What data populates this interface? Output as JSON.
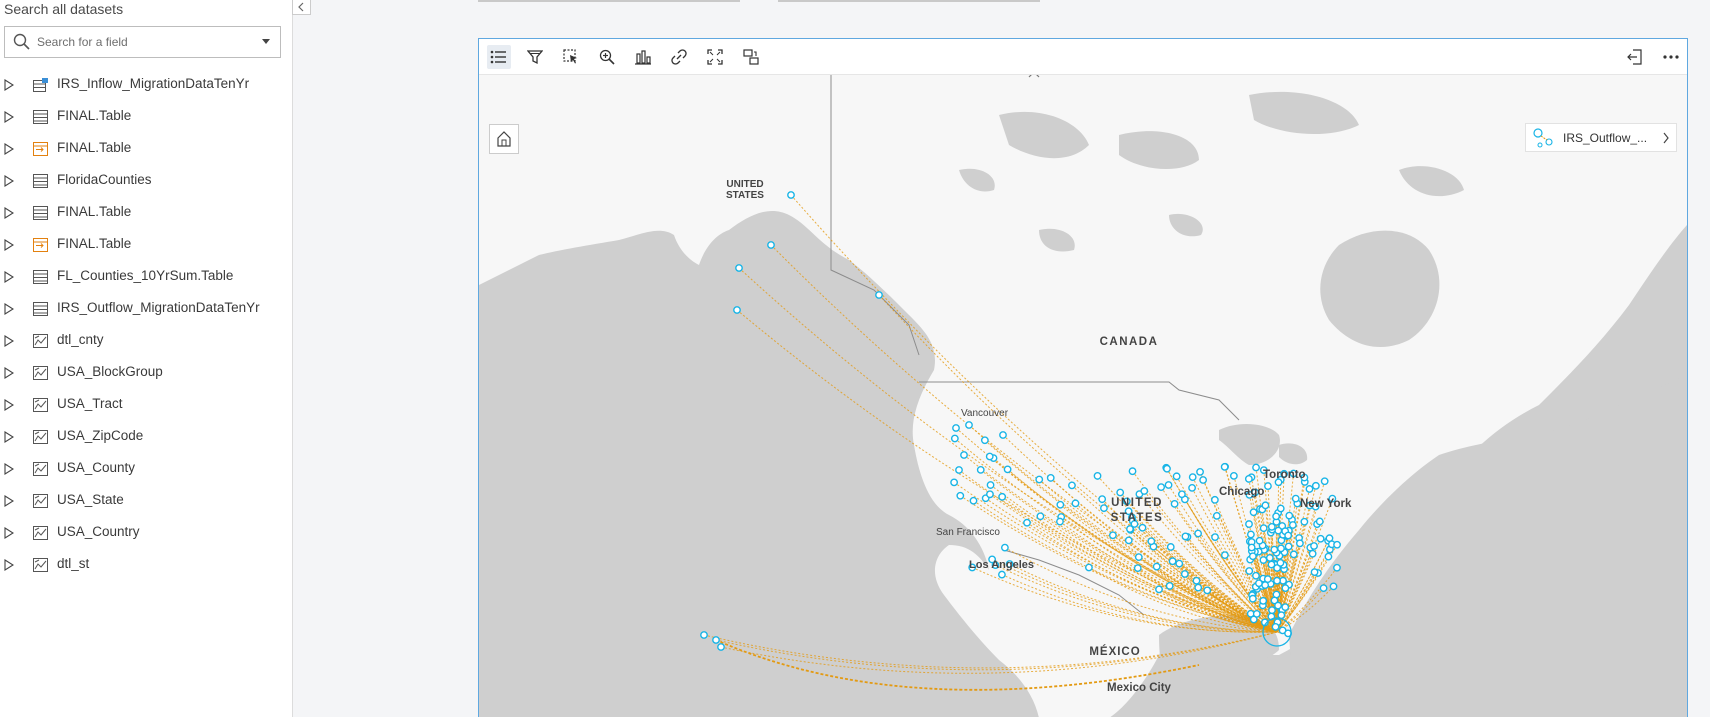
{
  "sidebar": {
    "title": "Search all datasets",
    "search_placeholder": "Search for a field",
    "datasets": [
      {
        "label": "IRS_Inflow_MigrationDataTenYr",
        "icon": "spatial-table-icon"
      },
      {
        "label": "FINAL.Table",
        "icon": "table-icon"
      },
      {
        "label": "FINAL.Table",
        "icon": "joined-table-icon"
      },
      {
        "label": "FloridaCounties",
        "icon": "table-icon"
      },
      {
        "label": "FINAL.Table",
        "icon": "table-icon"
      },
      {
        "label": "FINAL.Table",
        "icon": "joined-table-icon"
      },
      {
        "label": "FL_Counties_10YrSum.Table",
        "icon": "table-icon"
      },
      {
        "label": "IRS_Outflow_MigrationDataTenYr",
        "icon": "table-icon"
      },
      {
        "label": "dtl_cnty",
        "icon": "boundary-layer-icon"
      },
      {
        "label": "USA_BlockGroup",
        "icon": "boundary-layer-icon"
      },
      {
        "label": "USA_Tract",
        "icon": "boundary-layer-icon"
      },
      {
        "label": "USA_ZipCode",
        "icon": "boundary-layer-icon"
      },
      {
        "label": "USA_County",
        "icon": "boundary-layer-icon"
      },
      {
        "label": "USA_State",
        "icon": "boundary-layer-icon"
      },
      {
        "label": "USA_Country",
        "icon": "boundary-layer-icon"
      },
      {
        "label": "dtl_st",
        "icon": "boundary-layer-icon"
      }
    ]
  },
  "map": {
    "toolbar": [
      "legend-icon",
      "filter-icon",
      "select-icon",
      "zoom-icon",
      "chart-icon",
      "link-icon",
      "fullscreen-icon",
      "flip-card-icon"
    ],
    "legend_label": "IRS_Outflow_...",
    "labels": {
      "us_alaska_1": "UNITED",
      "us_alaska_2": "STATES",
      "canada": "CANADA",
      "us_1": "UNITED",
      "us_2": "STATES",
      "vancouver": "Vancouver",
      "toronto": "Toronto",
      "chicago": "Chicago",
      "new_york": "New York",
      "san_francisco": "San Francisco",
      "los_angeles": "Los Angeles",
      "mexico": "MÉXICO",
      "mexico_city": "Mexico City"
    },
    "colors": {
      "point": "#18b4e6",
      "flow": "#e39a12",
      "land": "#cfcfcf",
      "water": "#f7f7f7"
    }
  }
}
